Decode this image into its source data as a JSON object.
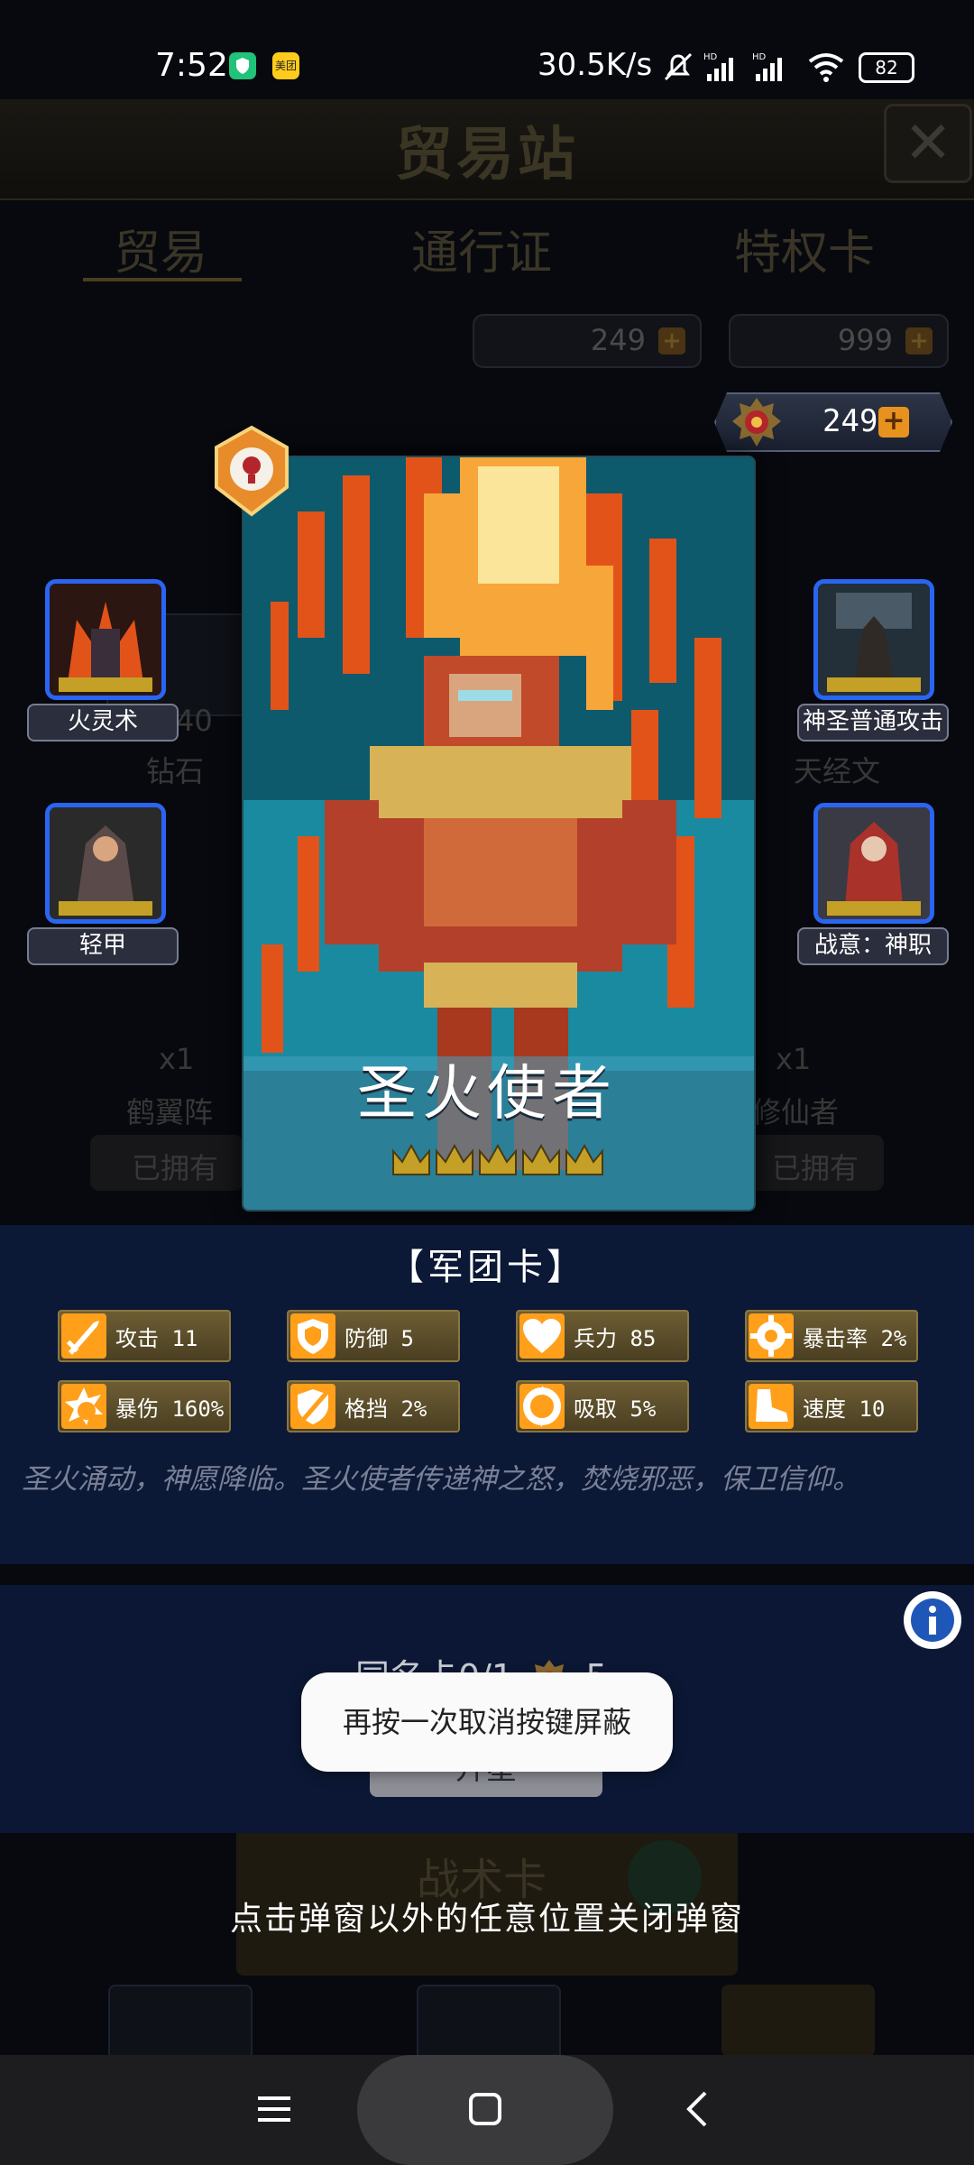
{
  "status_bar": {
    "time": "7:52",
    "app_icon_1": "shield-app-icon",
    "app_icon_2_label": "美团",
    "network_speed": "30.5K/s",
    "battery": "82"
  },
  "background": {
    "title": "贸易站",
    "tabs": [
      "贸易",
      "通行证",
      "特权卡"
    ],
    "currency_1": "249",
    "currency_2": "999",
    "items": {
      "diamond_qty": "40",
      "diamond_name": "钻石",
      "scripture_name": "天经文",
      "formation_qty": "x1",
      "formation_name": "鹤翼阵",
      "cultivator_qty": "x1",
      "cultivator_name": "修仙者",
      "owned_label_1": "已拥有",
      "owned_label_2": "已拥有"
    },
    "tactic_title": "战术卡"
  },
  "currency": {
    "value": "249",
    "plus": "+"
  },
  "hero": {
    "name": "圣火使者",
    "stars": 5
  },
  "skills": {
    "left_top": "火灵术",
    "left_bottom": "轻甲",
    "right_top": "神圣普通攻击",
    "right_bottom": "战意：神职"
  },
  "card_type": "【军团卡】",
  "stats": [
    {
      "label": "攻击 11",
      "icon": "sword-icon"
    },
    {
      "label": "防御 5",
      "icon": "shield-icon"
    },
    {
      "label": "兵力 85",
      "icon": "heart-icon"
    },
    {
      "label": "暴击率 2%",
      "icon": "crit-rate-icon"
    },
    {
      "label": "暴伤 160%",
      "icon": "crit-damage-icon"
    },
    {
      "label": "格挡 2%",
      "icon": "block-icon"
    },
    {
      "label": "吸取 5%",
      "icon": "lifesteal-icon"
    },
    {
      "label": "速度 10",
      "icon": "boot-icon"
    }
  ],
  "flavor_text": "圣火涌动，神愿降临。圣火使者传递神之怒，焚烧邪恶，保卫信仰。",
  "same_card": {
    "text": "同名卡0/1",
    "cost": "5",
    "upgrade_label": "升星"
  },
  "toast": "再按一次取消按键屏蔽",
  "close_hint": "点击弹窗以外的任意位置关闭弹窗",
  "colors": {
    "skill_border": "#2a65f2",
    "stat_icon": "#ff9f1a",
    "panel_bg": "#0b1836"
  }
}
